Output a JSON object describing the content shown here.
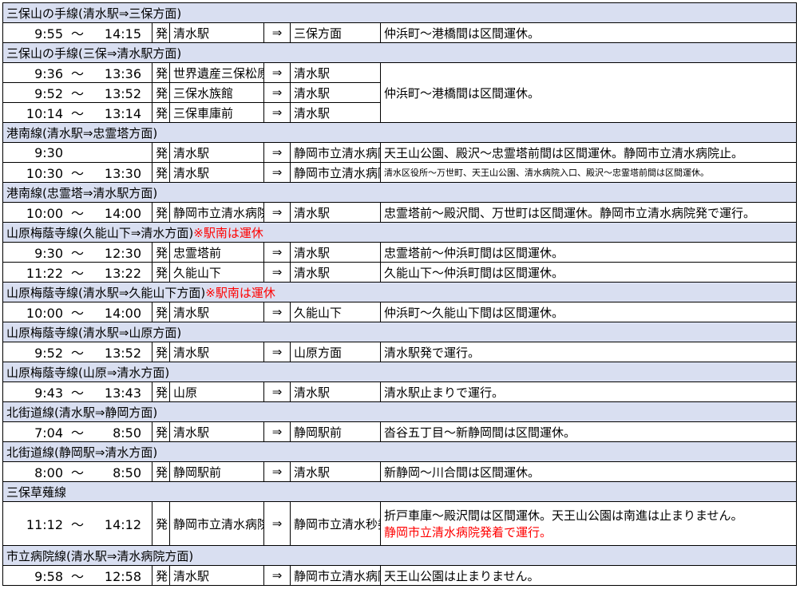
{
  "sections": [
    {
      "title": "三保山の手線(清水駅⇒三保方面)",
      "title_suffix": "",
      "rows": [
        {
          "start": "9:55",
          "tilde": "～",
          "end": "14:15",
          "hatsu": "発",
          "from": "清水駅",
          "arrow": "⇒",
          "to": "三保方面",
          "note": "仲浜町～港橋間は区間運休。"
        }
      ]
    },
    {
      "title": "三保山の手線(三保⇒清水駅方面)",
      "title_suffix": "",
      "rows": [
        {
          "start": "9:36",
          "tilde": "～",
          "end": "13:36",
          "hatsu": "発",
          "from": "世界遺産三保松原",
          "arrow": "⇒",
          "to": "清水駅"
        },
        {
          "start": "9:52",
          "tilde": "～",
          "end": "13:52",
          "hatsu": "発",
          "from": "三保水族館",
          "arrow": "⇒",
          "to": "清水駅"
        },
        {
          "start": "10:14",
          "tilde": "～",
          "end": "13:14",
          "hatsu": "発",
          "from": "三保車庫前",
          "arrow": "⇒",
          "to": "清水駅"
        }
      ],
      "merged_note": "仲浜町～港橋間は区間運休。"
    },
    {
      "title": "港南線(清水駅⇒忠霊塔方面)",
      "title_suffix": "",
      "rows": [
        {
          "start": "9:30",
          "tilde": "",
          "end": "",
          "hatsu": "発",
          "from": "清水駅",
          "arrow": "⇒",
          "to": "静岡市立清水病院",
          "note": "天王山公園、殿沢～忠霊塔前間は区間運休。静岡市立清水病院止。"
        },
        {
          "start": "10:30",
          "tilde": "～",
          "end": "13:30",
          "hatsu": "発",
          "from": "清水駅",
          "arrow": "⇒",
          "to": "静岡市立清水病院",
          "note": "清水区役所～万世町、天王山公園、清水病院入口、殿沢～忠霊塔前間は区間運休。"
        }
      ]
    },
    {
      "title": "港南線(忠霊塔⇒清水駅方面)",
      "title_suffix": "",
      "rows": [
        {
          "start": "10:00",
          "tilde": "～",
          "end": "14:00",
          "hatsu": "発",
          "from": "静岡市立清水病院",
          "arrow": "⇒",
          "to": "清水駅",
          "note": "忠霊塔前～殿沢間、万世町は区間運休。静岡市立清水病院発で運行。"
        }
      ]
    },
    {
      "title": "山原梅蔭寺線(久能山下⇒清水方面)",
      "title_suffix": "※駅南は運休",
      "rows": [
        {
          "start": "9:30",
          "tilde": "～",
          "end": "12:30",
          "hatsu": "発",
          "from": "忠霊塔前",
          "arrow": "⇒",
          "to": "清水駅",
          "note": "忠霊塔前～仲浜町間は区間運休。"
        },
        {
          "start": "11:22",
          "tilde": "～",
          "end": "13:22",
          "hatsu": "発",
          "from": "久能山下",
          "arrow": "⇒",
          "to": "清水駅",
          "note": "久能山下～仲浜町間は区間運休。"
        }
      ]
    },
    {
      "title": "山原梅蔭寺線(清水駅⇒久能山下方面)",
      "title_suffix": "※駅南は運休",
      "rows": [
        {
          "start": "10:00",
          "tilde": "～",
          "end": "14:00",
          "hatsu": "発",
          "from": "清水駅",
          "arrow": "⇒",
          "to": "久能山下",
          "note": "仲浜町～久能山下間は区間運休。"
        }
      ]
    },
    {
      "title": "山原梅蔭寺線(清水駅⇒山原方面)",
      "title_suffix": "",
      "rows": [
        {
          "start": "9:52",
          "tilde": "～",
          "end": "13:52",
          "hatsu": "発",
          "from": "清水駅",
          "arrow": "⇒",
          "to": "山原方面",
          "note": "清水駅発で運行。"
        }
      ]
    },
    {
      "title": "山原梅蔭寺線(山原⇒清水方面)",
      "title_suffix": "",
      "rows": [
        {
          "start": "9:43",
          "tilde": "～",
          "end": "13:43",
          "hatsu": "発",
          "from": "山原",
          "arrow": "⇒",
          "to": "清水駅",
          "note": "清水駅止まりで運行。"
        }
      ]
    },
    {
      "title": "北街道線(清水駅⇒静岡方面)",
      "title_suffix": "",
      "rows": [
        {
          "start": "7:04",
          "tilde": "～",
          "end": "8:50",
          "hatsu": "発",
          "from": "清水駅",
          "arrow": "⇒",
          "to": "静岡駅前",
          "note": "沓谷五丁目～新静岡間は区間運休。"
        }
      ]
    },
    {
      "title": "北街道線(静岡駅⇒清水方面)",
      "title_suffix": "",
      "rows": [
        {
          "start": "8:00",
          "tilde": "～",
          "end": "8:50",
          "hatsu": "発",
          "from": "静岡駅前",
          "arrow": "⇒",
          "to": "清水駅",
          "note": "新静岡～川合間は区間運休。"
        }
      ]
    },
    {
      "title": "三保草薙線",
      "title_suffix": "",
      "rows": [
        {
          "start": "11:12",
          "tilde": "～",
          "end": "14:12",
          "hatsu": "発",
          "from": "静岡市立清水病院",
          "arrow": "⇒",
          "to": "静岡市立清水秒委員",
          "note": "折戸車庫～殿沢間は区間運休。天王山公園は南進は止まりません。",
          "note2": "静岡市立清水病院発着で運行。"
        }
      ]
    },
    {
      "title": "市立病院線(清水駅⇒清水病院方面)",
      "title_suffix": "",
      "rows": [
        {
          "start": "9:58",
          "tilde": "～",
          "end": "12:58",
          "hatsu": "発",
          "from": "清水駅",
          "arrow": "⇒",
          "to": "静岡市立清水病院",
          "note": "天王山公園は止まりません。"
        }
      ]
    }
  ]
}
